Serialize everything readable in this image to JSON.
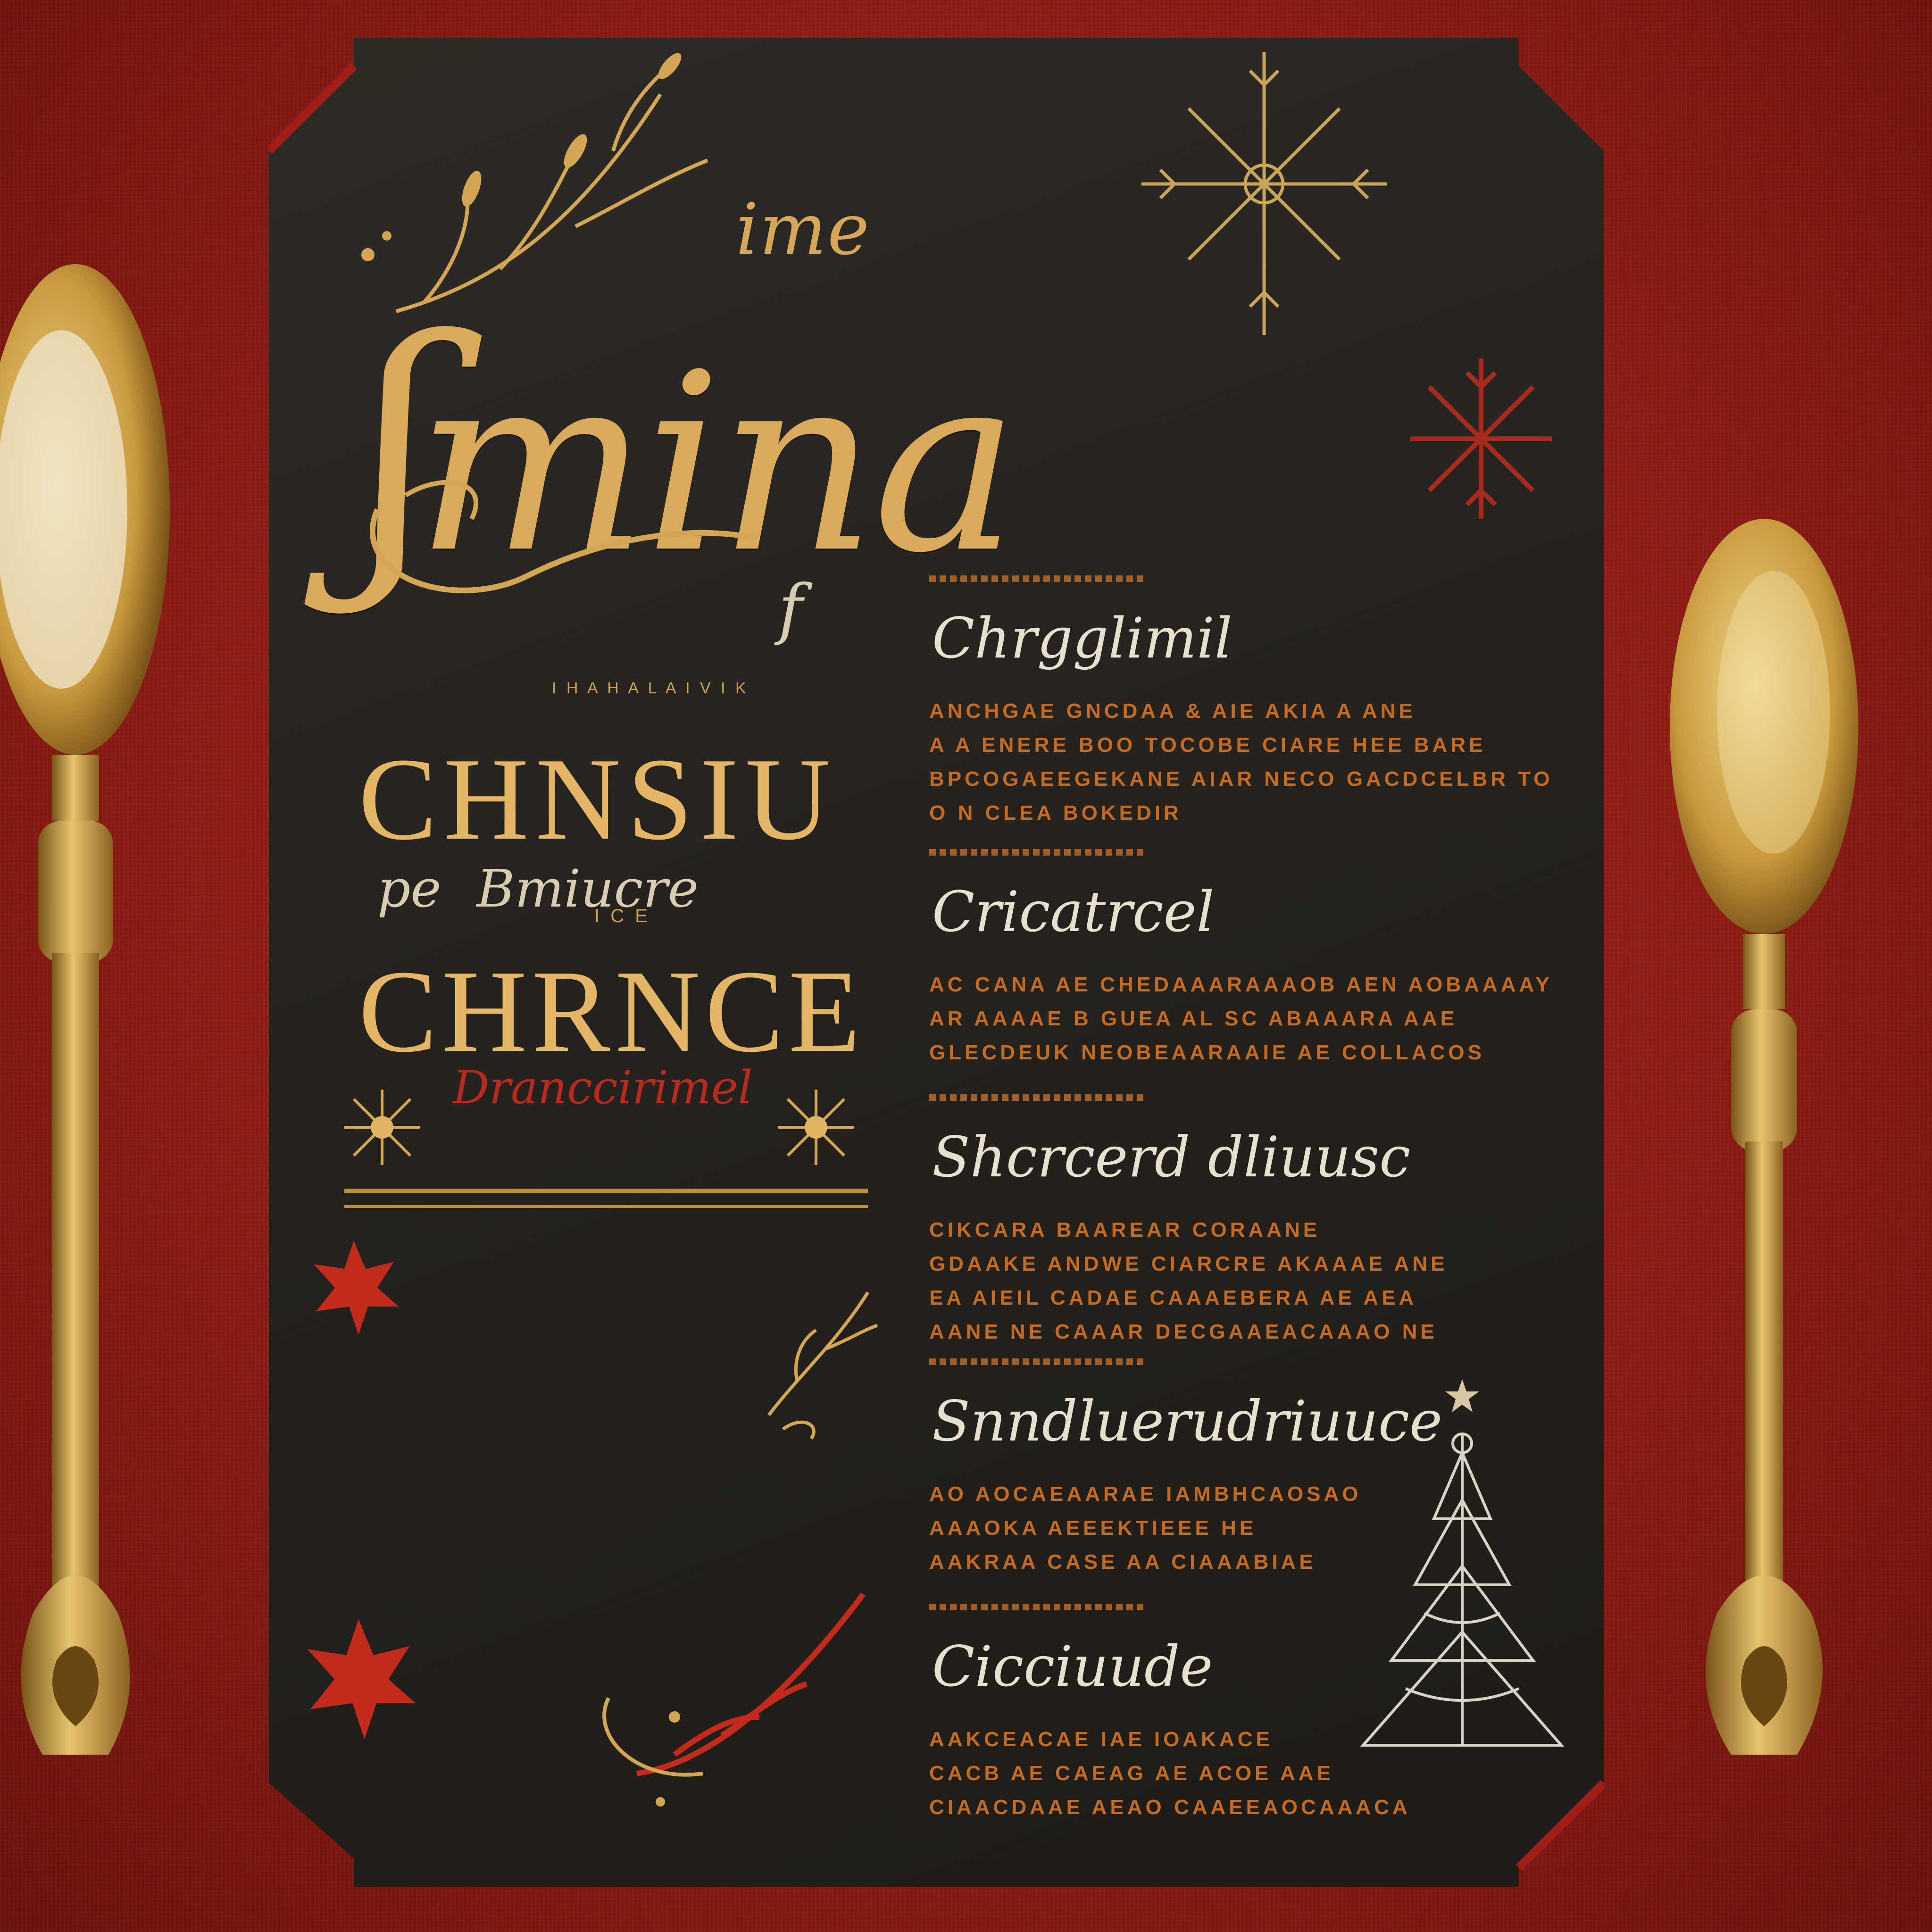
{
  "menu": {
    "title_small": "ime",
    "title_big": "mina",
    "left": {
      "fragment": "f",
      "small_top": "I H A H A L A I V I K",
      "heading_1": "CHNSIU",
      "subtitle_prefix": "pe",
      "subtitle": "Bmiucre",
      "small_mid": "I C E",
      "heading_2": "CHRNCE",
      "red_script": "Dranccirimel"
    },
    "sections": [
      {
        "heading": "Chrgglimil",
        "lines": [
          "ANCHGAE GNCDAA & AIE AKIA A ANE",
          "A A ENERE BOO TOCOBE CIARE HEE BARE",
          "BPCOGAEEGEKANE AIAR NECO GACDCELBR TOO",
          "O N CLEA BOKEDIR"
        ]
      },
      {
        "heading": "Cricatrcel",
        "lines": [
          "AC CANA AE CHEDAAARAAAOB AEN AOBAAAAYC",
          "AR AAAAE B GUEA AL SC ABAAARA AAE",
          "GLECDEUK NEOBEAARAAIE AE COLLACOS"
        ]
      },
      {
        "heading": "Shcrcerd dliuusc",
        "lines": [
          "CIKCARA BAAREAR CORAANE",
          "GDAAKE ANDWE CIARCRE AKAAAE ANE",
          "EA AIEIL CADAE CAAAEBERA AE AEA",
          "AANE NE CAAAR DECGAAEACAAAO NE"
        ]
      },
      {
        "heading": "Snndluerudriuuce",
        "lines": [
          "AO AOCAEAARAE IAMBHCAOSAO",
          "AAAOKA AEEEKTIEEE HE",
          "AAKRAA CASE AA CIAAABIAE"
        ]
      },
      {
        "heading": "Cicciuude",
        "lines": [
          "AAKCEACAE IAE IOAKACE",
          "CACB AE CAEAG AE ACOE AAE",
          "CIAACDAAE AEAO CAAEEAOCAAACA"
        ]
      }
    ]
  },
  "colors": {
    "tablecloth": "#8e1c14",
    "card": "#26221e",
    "gold": "#d9aa5c",
    "accent_red": "#b72a1f",
    "body_text": "#c36a23",
    "heading_text": "#e8e0cf"
  },
  "icons": [
    "laurel-branch-icon",
    "snowflake-icon",
    "red-snowflake-icon",
    "sunburst-icon",
    "maple-leaf-icon",
    "christmas-tree-icon",
    "star-icon",
    "gold-spoon-icon"
  ]
}
